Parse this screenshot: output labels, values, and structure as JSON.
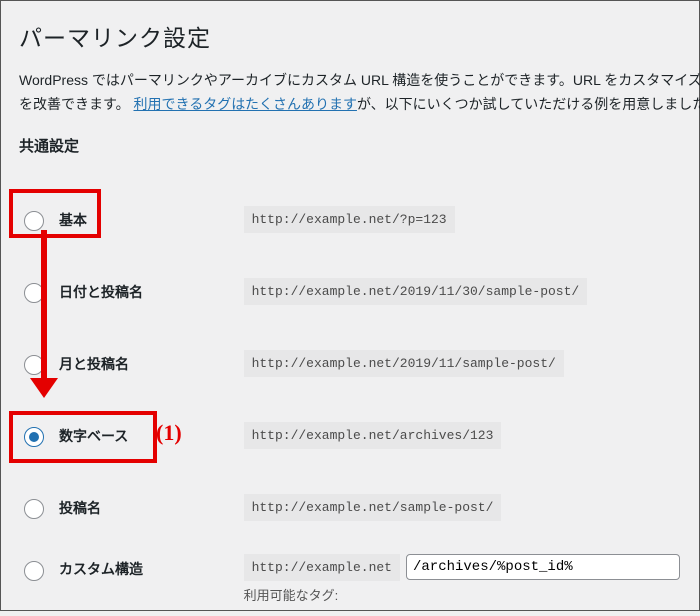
{
  "page_title": "パーマリンク設定",
  "intro": {
    "before_link": "WordPress ではパーマリンクやアーカイブにカスタム URL 構造を使うことができます。URL をカスタマイズすることで、リンクの美しさや使いやすさ、そして前方互換性を改善できます。",
    "prefix": "を改善できます。",
    "link_text": "利用できるタグはたくさんあります",
    "after_link": "が、以下にいくつか試していただける例を用意しました。"
  },
  "section_heading": "共通設定",
  "options": {
    "plain": {
      "label": "基本",
      "example": "http://example.net/?p=123",
      "checked": false
    },
    "dayname": {
      "label": "日付と投稿名",
      "example": "http://example.net/2019/11/30/sample-post/",
      "checked": false
    },
    "monthname": {
      "label": "月と投稿名",
      "example": "http://example.net/2019/11/sample-post/",
      "checked": false
    },
    "numeric": {
      "label": "数字ベース",
      "example": "http://example.net/archives/123",
      "checked": true
    },
    "postname": {
      "label": "投稿名",
      "example": "http://example.net/sample-post/",
      "checked": false
    },
    "custom": {
      "label": "カスタム構造",
      "base": "http://example.net",
      "value": "/archives/%post_id%",
      "checked": false
    }
  },
  "tags_hint": "利用可能なタグ:",
  "annotation": {
    "label": "(1)"
  }
}
